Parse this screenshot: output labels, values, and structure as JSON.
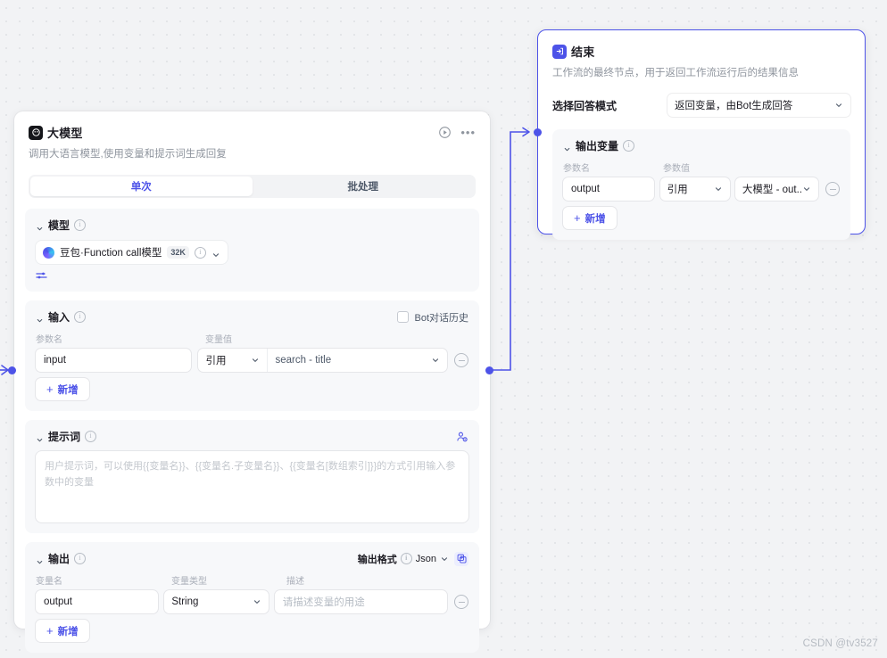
{
  "canvas": {
    "background_color": "#f2f3f5",
    "accent_color": "#4d53e8",
    "watermark": "CSDN @tv3527"
  },
  "llm_node": {
    "icon": "llm-node-icon",
    "title": "大模型",
    "description": "调用大语言模型,使用变量和提示词生成回复",
    "run_icon": "play-circle-icon",
    "more_icon": "more-options-icon",
    "tabs": [
      {
        "label": "单次",
        "active": true
      },
      {
        "label": "批处理",
        "active": false
      }
    ],
    "model_section": {
      "title": "模型",
      "info_icon": "info-icon",
      "model_name": "豆包·Function call模型",
      "context_badge": "32K",
      "model_info_icon": "info-icon",
      "model_chevron": "chevron-down-icon",
      "settings_icon": "sliders-icon"
    },
    "input_section": {
      "title": "输入",
      "info_icon": "info-icon",
      "checkbox_label": "Bot对话历史",
      "checkbox_checked": false,
      "col_param_name": "参数名",
      "col_variable_value": "变量值",
      "rows": [
        {
          "name": "input",
          "source": "引用",
          "value": "search - title"
        }
      ],
      "add_label": "新增"
    },
    "prompt_section": {
      "title": "提示词",
      "info_icon": "info-icon",
      "user_icon": "user-settings-icon",
      "placeholder": "用户提示词，可以使用{{变量名}}、{{变量名.子变量名}}、{{变量名[数组索引]}}的方式引用输入参数中的变量"
    },
    "output_section": {
      "title": "输出",
      "info_icon": "info-icon",
      "format_label": "输出格式",
      "format_info_icon": "info-icon",
      "format_value": "Json",
      "format_chevron": "chevron-down-icon",
      "expand_icon": "expand-code-icon",
      "col_var_name": "变量名",
      "col_var_type": "变量类型",
      "col_description": "描述",
      "rows": [
        {
          "name": "output",
          "type": "String",
          "desc_placeholder": "请描述变量的用途"
        }
      ],
      "add_label": "新增"
    }
  },
  "end_node": {
    "icon": "end-node-icon",
    "title": "结束",
    "description": "工作流的最终节点，用于返回工作流运行后的结果信息",
    "mode_label": "选择回答模式",
    "mode_value": "返回变量，由Bot生成回答",
    "mode_chevron": "chevron-down-icon",
    "output_section": {
      "title": "输出变量",
      "info_icon": "info-icon",
      "col_param_name": "参数名",
      "col_param_value": "参数值",
      "rows": [
        {
          "name": "output",
          "source": "引用",
          "value": "大模型 - out.."
        }
      ],
      "add_label": "新增"
    }
  }
}
